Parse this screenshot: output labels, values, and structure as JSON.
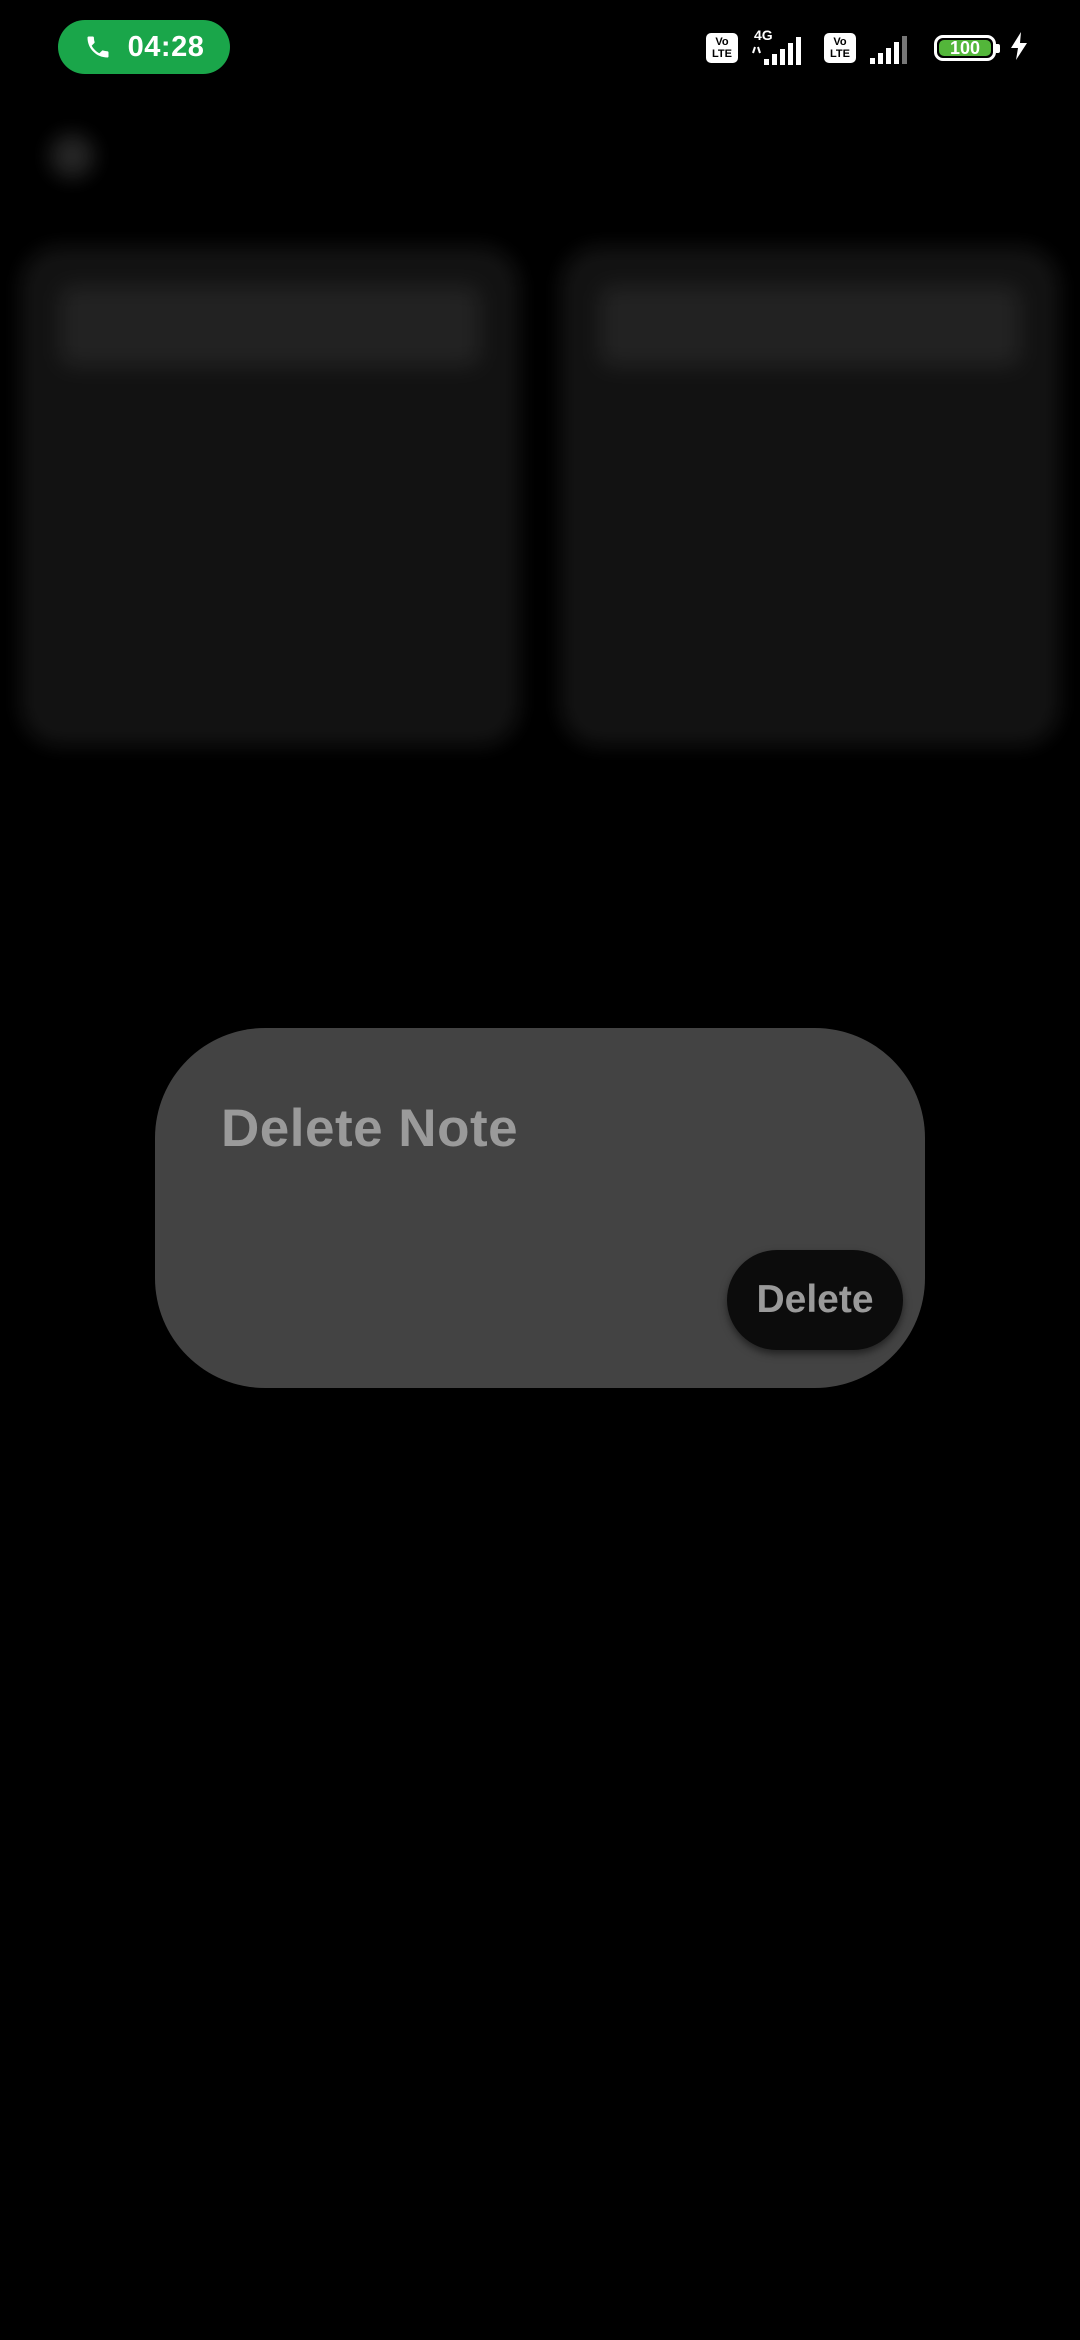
{
  "status_bar": {
    "call_time": "04:28",
    "call_icon": "phone-icon",
    "sim1_badge": [
      "Vo",
      "LTE"
    ],
    "network_type": "4G",
    "sim2_badge": [
      "Vo",
      "LTE"
    ],
    "battery_level": "100",
    "charging_icon": "lightning-bolt-icon",
    "colors": {
      "call_pill": "#1aa64a",
      "battery_fill": "#53b63a"
    }
  },
  "background_app": {
    "back_icon": "back-icon"
  },
  "dialog": {
    "title": "Delete Note",
    "delete_label": "Delete",
    "colors": {
      "surface": "#434343",
      "button": "#0c0c0c",
      "text": "#9a9a9a"
    }
  }
}
